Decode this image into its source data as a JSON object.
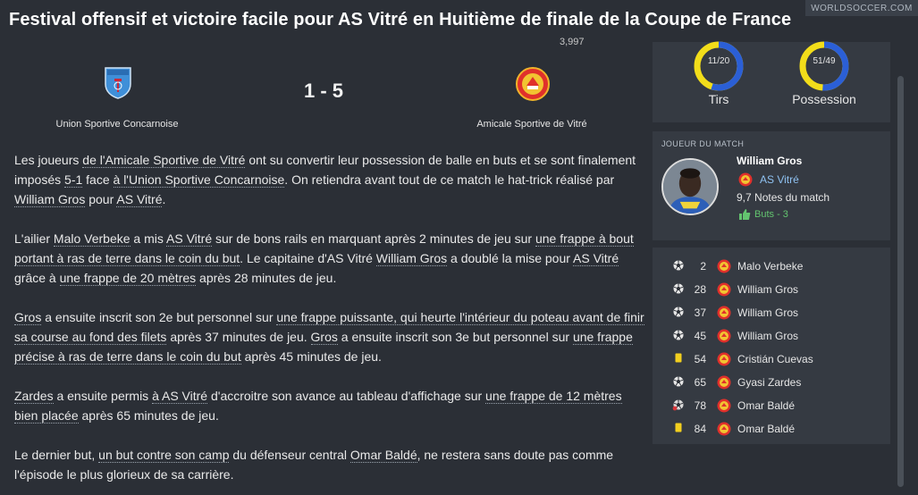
{
  "header": {
    "title": "Festival offensif et victoire facile pour AS Vitré en Huitième de finale de la Coupe de France",
    "brand": "WORLDSOCCER.COM"
  },
  "match": {
    "home_team": "Union Sportive Concarnoise",
    "away_team": "Amicale Sportive de Vitré",
    "score": "1 - 5",
    "attendance": "3,997"
  },
  "article": {
    "paragraphs": [
      [
        {
          "t": "Les joueurs "
        },
        {
          "t": "de l'Amicale Sportive de Vitré",
          "link": true
        },
        {
          "t": " ont su convertir leur possession de balle en buts et se sont finalement imposés "
        },
        {
          "t": "5-1",
          "link": true
        },
        {
          "t": " face "
        },
        {
          "t": "à l'Union Sportive Concarnoise",
          "link": true
        },
        {
          "t": ". On retiendra avant tout de ce match le hat-trick réalisé par "
        },
        {
          "t": "William Gros",
          "link": true
        },
        {
          "t": " pour "
        },
        {
          "t": "AS Vitré",
          "link": true
        },
        {
          "t": "."
        }
      ],
      [
        {
          "t": "L'ailier "
        },
        {
          "t": "Malo Verbeke",
          "link": true
        },
        {
          "t": " a mis "
        },
        {
          "t": "AS Vitré",
          "link": true
        },
        {
          "t": " sur de bons rails en marquant après 2 minutes de jeu sur "
        },
        {
          "t": "une frappe à bout portant à ras de terre dans le coin du but",
          "link": true
        },
        {
          "t": ". Le capitaine d'AS Vitré "
        },
        {
          "t": "William Gros",
          "link": true
        },
        {
          "t": " a doublé la mise pour "
        },
        {
          "t": "AS Vitré",
          "link": true
        },
        {
          "t": " grâce à "
        },
        {
          "t": "une frappe de 20 mètres",
          "link": true
        },
        {
          "t": " après 28 minutes de jeu."
        }
      ],
      [
        {
          "t": "Gros",
          "link": true
        },
        {
          "t": " a ensuite inscrit son 2e but personnel sur "
        },
        {
          "t": "une frappe puissante, qui heurte l'intérieur du poteau avant de finir sa course au fond des filets",
          "link": true
        },
        {
          "t": " après 37 minutes de jeu. "
        },
        {
          "t": "Gros",
          "link": true
        },
        {
          "t": " a ensuite inscrit son 3e but personnel sur "
        },
        {
          "t": "une frappe précise à ras de terre dans le coin du but",
          "link": true
        },
        {
          "t": " après 45 minutes de jeu."
        }
      ],
      [
        {
          "t": "Zardes",
          "link": true
        },
        {
          "t": " a ensuite permis "
        },
        {
          "t": "à AS Vitré",
          "link": true
        },
        {
          "t": " d'accroitre son avance au tableau d'affichage sur "
        },
        {
          "t": "une frappe de 12 mètres bien placée",
          "link": true
        },
        {
          "t": " après 65 minutes de jeu."
        }
      ],
      [
        {
          "t": "Le dernier but, "
        },
        {
          "t": "un but contre son camp",
          "link": true
        },
        {
          "t": " du défenseur central "
        },
        {
          "t": "Omar Baldé",
          "link": true
        },
        {
          "t": ", ne restera sans doute pas comme l'épisode le plus glorieux de sa carrière."
        }
      ]
    ]
  },
  "stats": {
    "shots_value": "11/20",
    "shots_label": "Tirs",
    "shots_fraction": 0.55,
    "possession_value": "51/49",
    "possession_label": "Possession",
    "possession_fraction": 0.51,
    "home_ring_color": "#2b5fd6",
    "away_ring_color": "#f2dd1a"
  },
  "motm": {
    "heading": "JOUEUR DU MATCH",
    "name": "William Gros",
    "club": "AS Vitré",
    "rating_value": "9,7",
    "rating_label": "Notes du match",
    "goals": "Buts - 3"
  },
  "events": [
    {
      "type": "goal-icon",
      "minute": "2",
      "player": "Malo Verbeke"
    },
    {
      "type": "goal-icon",
      "minute": "28",
      "player": "William Gros"
    },
    {
      "type": "goal-icon",
      "minute": "37",
      "player": "William Gros"
    },
    {
      "type": "goal-icon",
      "minute": "45",
      "player": "William Gros"
    },
    {
      "type": "yellow-card-icon",
      "minute": "54",
      "player": "Cristián Cuevas"
    },
    {
      "type": "goal-icon",
      "minute": "65",
      "player": "Gyasi Zardes"
    },
    {
      "type": "own-goal-icon",
      "minute": "78",
      "player": "Omar Baldé"
    },
    {
      "type": "yellow-card-icon",
      "minute": "84",
      "player": "Omar Baldé"
    }
  ]
}
